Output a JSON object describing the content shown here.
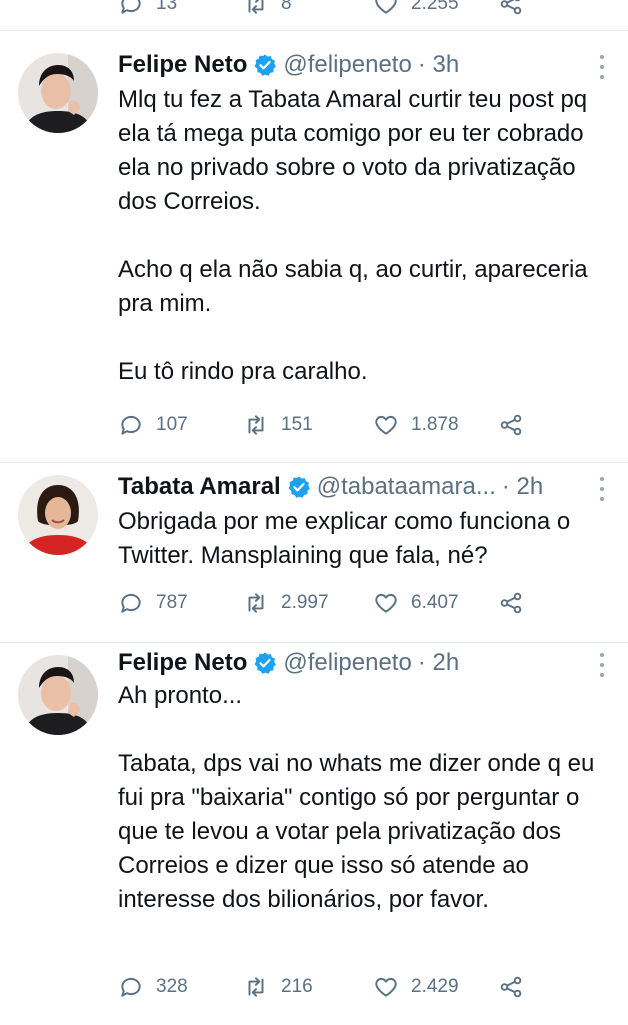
{
  "top_actions": {
    "reply_count": "13",
    "retweet_count": "8",
    "like_count": "2.255"
  },
  "tweets": [
    {
      "name": "Felipe Neto",
      "handle": "@felipeneto",
      "time": "· 3h",
      "text": "Mlq tu fez a Tabata Amaral curtir teu post pq ela tá mega puta comigo por eu ter cobrado ela no privado sobre o voto da privatização dos Correios.\n\nAcho q ela não sabia q, ao curtir, apareceria pra mim.\n\nEu tô rindo pra caralho.",
      "reply_count": "107",
      "retweet_count": "151",
      "like_count": "1.878"
    },
    {
      "name": "Tabata Amaral",
      "handle": "@tabataamara...",
      "time": "· 2h",
      "text": "Obrigada por me explicar como funciona o Twitter. Mansplaining que fala, né?",
      "reply_count": "787",
      "retweet_count": "2.997",
      "like_count": "6.407"
    },
    {
      "name": "Felipe Neto",
      "handle": "@felipeneto",
      "time": "· 2h",
      "text": "Ah pronto...\n\nTabata, dps vai no whats me dizer onde q eu fui pra \"baixaria\" contigo só por perguntar o que te levou a votar pela privatização dos Correios e dizer que isso só atende ao interesse dos bilionários, por favor.",
      "reply_count": "328",
      "retweet_count": "216",
      "like_count": "2.429"
    }
  ],
  "colors": {
    "text": "#0f1419",
    "secondary": "#5b7083",
    "verified": "#1da1f2"
  }
}
